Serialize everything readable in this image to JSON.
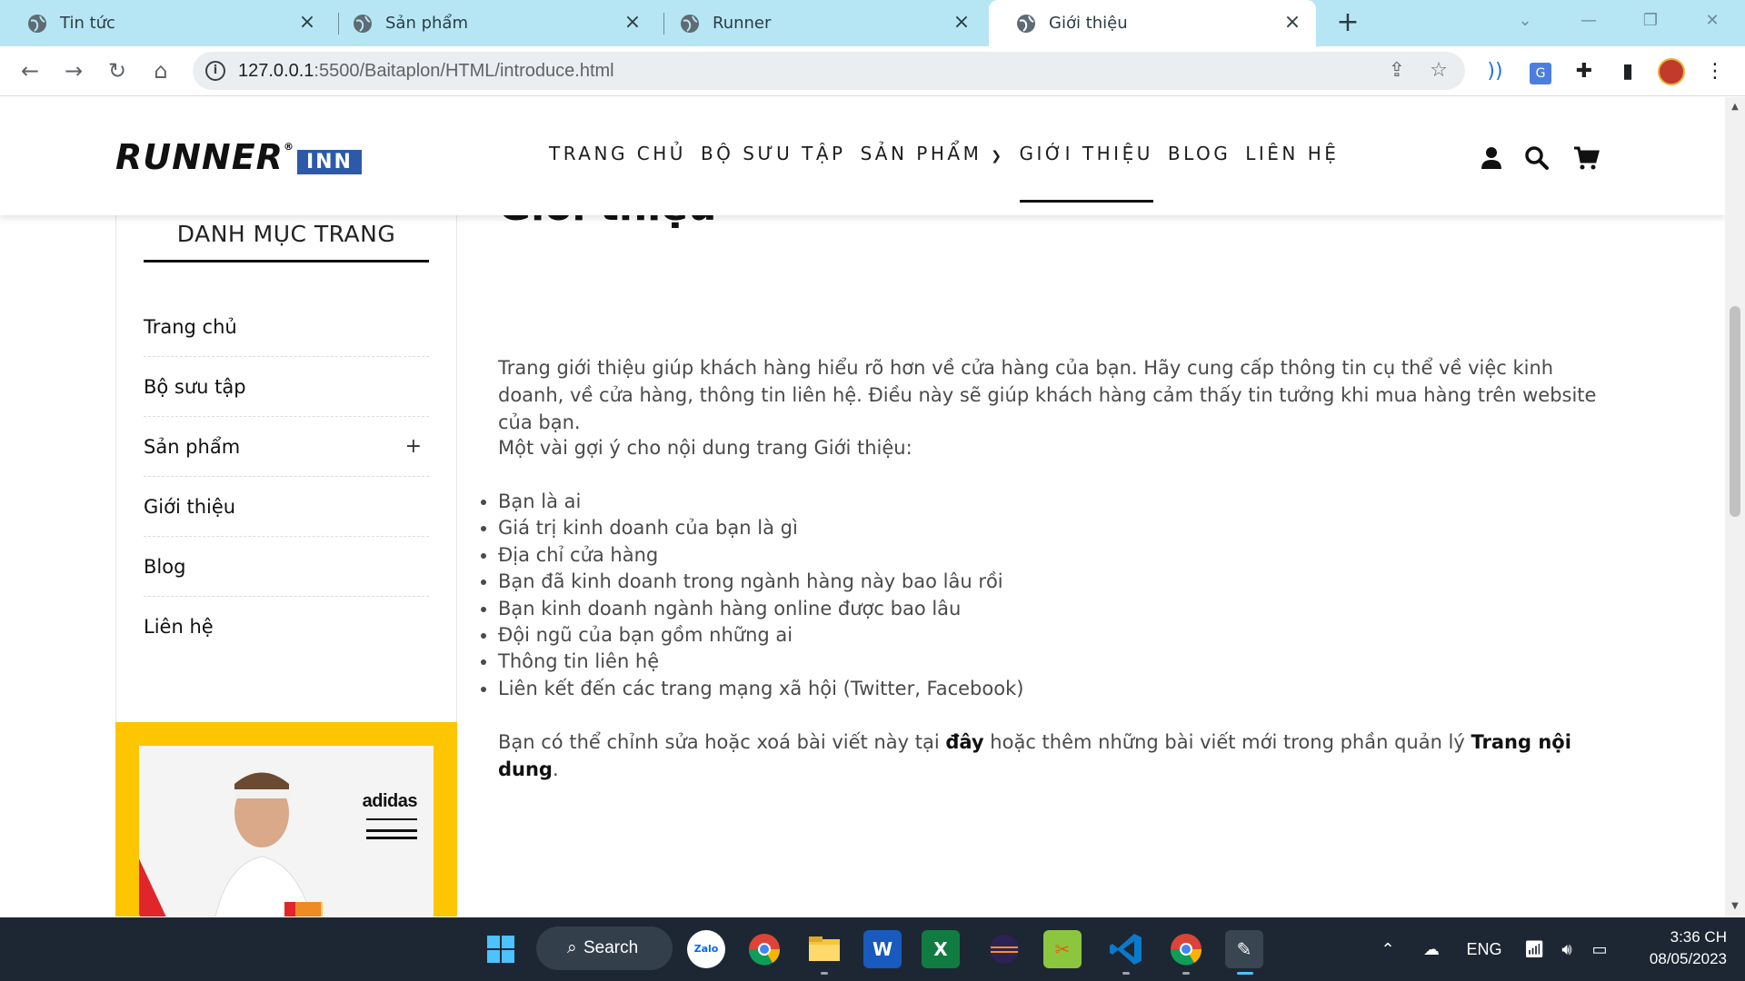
{
  "browser": {
    "tabs": [
      {
        "title": "Tin tức"
      },
      {
        "title": "Sản phẩm"
      },
      {
        "title": "Runner"
      },
      {
        "title": "Giới thiệu"
      }
    ],
    "url_host": "127.0.0.1",
    "url_path": ":5500/Baitaplon/HTML/introduce.html"
  },
  "site": {
    "logo_main": "RUNNER",
    "logo_reg": "®",
    "logo_badge": "INN",
    "nav": [
      {
        "label": "TRANG CHỦ"
      },
      {
        "label": "BỘ SƯU TẬP"
      },
      {
        "label": "SẢN PHẨM"
      },
      {
        "label": "GIỚI THIỆU"
      },
      {
        "label": "BLOG"
      },
      {
        "label": "LIÊN HỆ"
      }
    ]
  },
  "sidebar": {
    "title": "DANH MỤC TRANG",
    "items": [
      {
        "label": "Trang chủ"
      },
      {
        "label": "Bộ sưu tập"
      },
      {
        "label": "Sản phẩm",
        "expand": "+"
      },
      {
        "label": "Giới thiệu"
      },
      {
        "label": "Blog"
      },
      {
        "label": "Liên hệ"
      }
    ],
    "banner_brand": "adidas"
  },
  "main": {
    "heading": "Giới thiệu",
    "para1": "Trang giới thiệu giúp khách hàng hiểu rõ hơn về cửa hàng của bạn. Hãy cung cấp thông tin cụ thể về việc kinh doanh, về cửa hàng, thông tin liên hệ. Điều này sẽ giúp khách hàng cảm thấy tin tưởng khi mua hàng trên website của bạn.",
    "para2": "Một vài gợi ý cho nội dung trang Giới thiệu:",
    "bullets": [
      "Bạn là ai",
      "Giá trị kinh doanh của bạn là gì",
      "Địa chỉ cửa hàng",
      "Bạn đã kinh doanh trong ngành hàng này bao lâu rồi",
      "Bạn kinh doanh ngành hàng online được bao lâu",
      "Đội ngũ của bạn gồm những ai",
      "Thông tin liên hệ",
      "Liên kết đến các trang mạng xã hội (Twitter, Facebook)"
    ],
    "para3_a": "Bạn có thể chỉnh sửa hoặc xoá bài viết này tại ",
    "para3_link1": "đây",
    "para3_b": " hoặc thêm những bài viết mới trong phần quản lý ",
    "para3_link2": "Trang nội dung",
    "para3_c": "."
  },
  "taskbar": {
    "search_label": "Search",
    "lang": "ENG",
    "time": "3:36 CH",
    "date": "08/05/2023"
  }
}
